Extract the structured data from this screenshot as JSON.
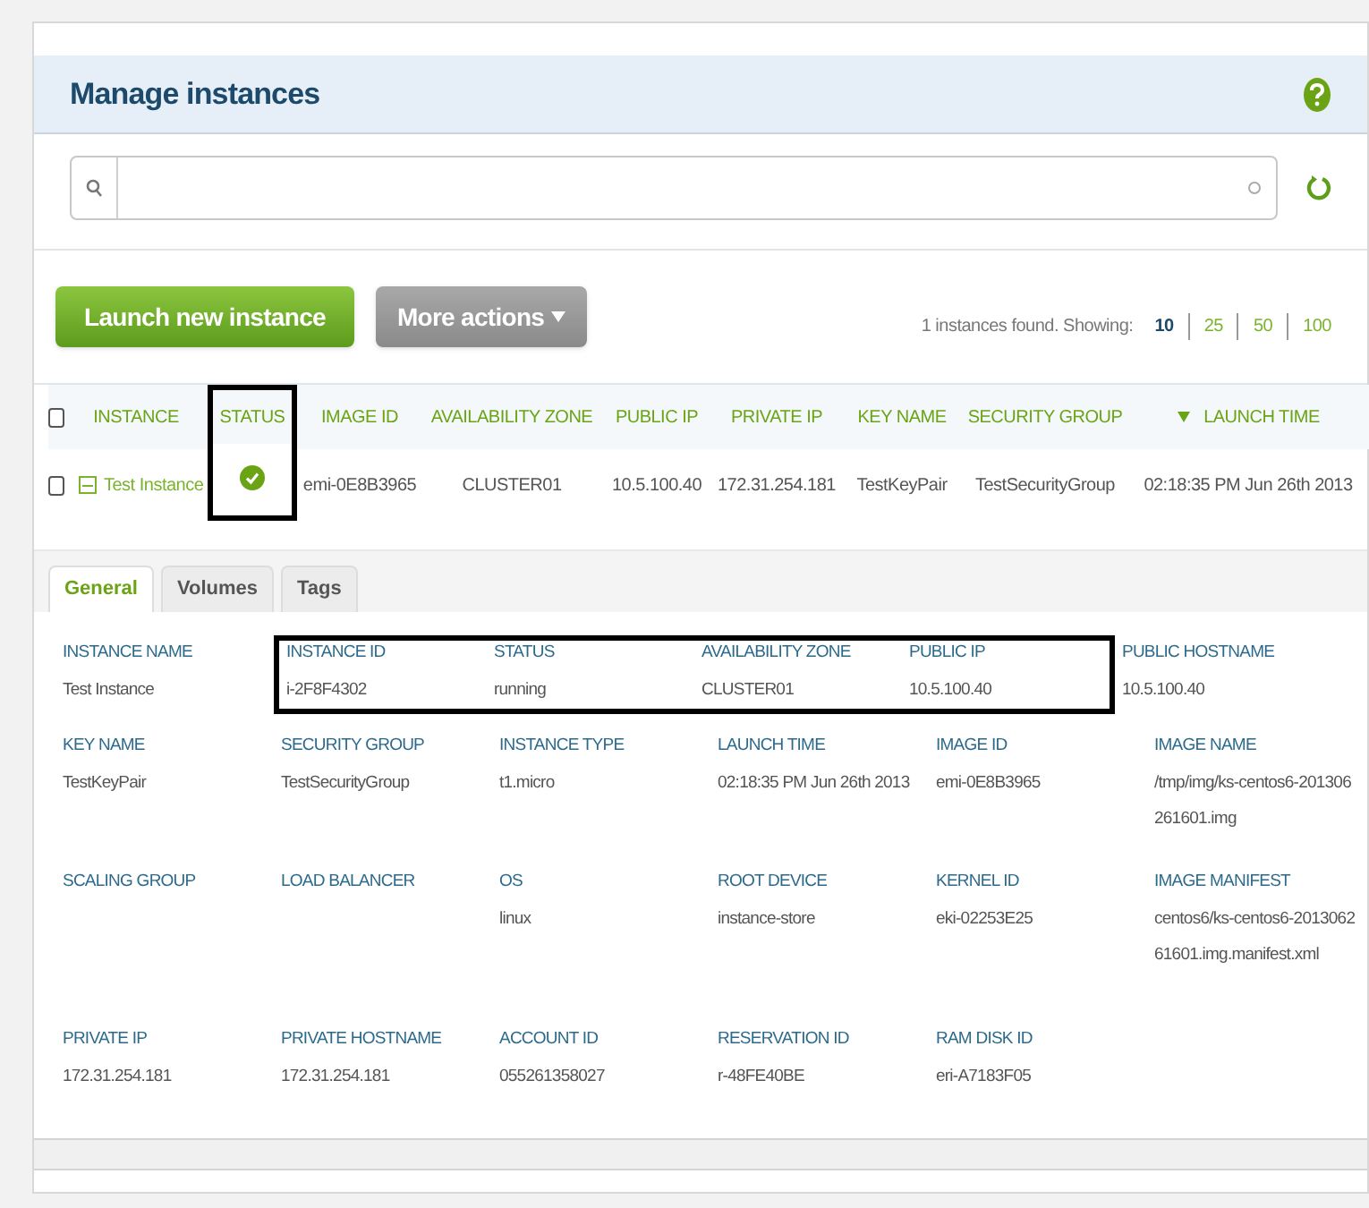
{
  "header": {
    "title": "Manage instances"
  },
  "actions": [
    {
      "kind": "primary",
      "label": "Launch new instance",
      "disabled": false
    },
    {
      "kind": "menu",
      "label": "More actions",
      "disabled": true
    }
  ],
  "summary": "1 instances found. Showing:",
  "page_sizes": [
    {
      "label": "10",
      "selected": true
    },
    {
      "label": "25",
      "selected": false
    },
    {
      "label": "50",
      "selected": false
    },
    {
      "label": "100",
      "selected": false
    }
  ],
  "table": {
    "select_all": {
      "checked": false
    },
    "columns": [
      {
        "label": "INSTANCE",
        "highlighted": false,
        "sorted": false
      },
      {
        "label": "STATUS",
        "highlighted": true,
        "sorted": false
      },
      {
        "label": "IMAGE ID",
        "highlighted": false,
        "sorted": false
      },
      {
        "label": "AVAILABILITY ZONE",
        "highlighted": false,
        "sorted": false
      },
      {
        "label": "PUBLIC IP",
        "highlighted": false,
        "sorted": false
      },
      {
        "label": "PRIVATE IP",
        "highlighted": false,
        "sorted": false
      },
      {
        "label": "KEY NAME",
        "highlighted": false,
        "sorted": false
      },
      {
        "label": "SECURITY GROUP",
        "highlighted": false,
        "sorted": false
      },
      {
        "label": "LAUNCH TIME",
        "highlighted": false,
        "sorted": true
      }
    ],
    "rows": [
      {
        "checked": false,
        "expanded": true,
        "kind": "running",
        "cells": [
          "Test Instance",
          "",
          "emi-0E8B3965",
          "CLUSTER01",
          "10.5.100.40",
          "172.31.254.181",
          "TestKeyPair",
          "TestSecurityGroup",
          "02:18:35 PM Jun 26th 2013"
        ]
      }
    ]
  },
  "detail_tabs": [
    {
      "label": "General",
      "selected": true
    },
    {
      "label": "Volumes",
      "selected": false
    },
    {
      "label": "Tags",
      "selected": false
    }
  ],
  "details": [
    [
      {
        "label": "INSTANCE NAME",
        "value": "Test Instance",
        "highlighted": false
      },
      {
        "label": "INSTANCE ID",
        "value": "i-2F8F4302",
        "highlighted": true
      },
      {
        "label": "STATUS",
        "value": "running",
        "highlighted": true
      },
      {
        "label": "AVAILABILITY ZONE",
        "value": "CLUSTER01",
        "highlighted": true
      },
      {
        "label": "PUBLIC IP",
        "value": "10.5.100.40",
        "highlighted": true
      },
      {
        "label": "PUBLIC HOSTNAME",
        "value": "10.5.100.40",
        "highlighted": false
      }
    ],
    [
      {
        "label": "KEY NAME",
        "value": "TestKeyPair",
        "highlighted": false
      },
      {
        "label": "SECURITY GROUP",
        "value": "TestSecurityGroup",
        "highlighted": false
      },
      {
        "label": "INSTANCE TYPE",
        "value": "t1.micro",
        "highlighted": false
      },
      {
        "label": "LAUNCH TIME",
        "value": "02:18:35 PM Jun 26th 2013",
        "highlighted": false
      },
      {
        "label": "IMAGE ID",
        "value": "emi-0E8B3965",
        "highlighted": false
      },
      {
        "label": "IMAGE NAME",
        "value": "/tmp/img/ks-centos6-201306261601.img",
        "highlighted": false
      }
    ],
    [
      {
        "label": "SCALING GROUP",
        "highlighted": false
      },
      {
        "label": "LOAD BALANCER",
        "highlighted": false
      },
      {
        "label": "OS",
        "value": "linux",
        "highlighted": false
      },
      {
        "label": "ROOT DEVICE",
        "value": "instance-store",
        "highlighted": false
      },
      {
        "label": "KERNEL ID",
        "value": "eki-02253E25",
        "highlighted": false
      },
      {
        "label": "IMAGE MANIFEST",
        "value": "centos6/ks-centos6-201306261601.img.manifest.xml",
        "highlighted": false
      }
    ],
    [
      {
        "label": "PRIVATE IP",
        "value": "172.31.254.181",
        "highlighted": false
      },
      {
        "label": "PRIVATE HOSTNAME",
        "value": "172.31.254.181",
        "highlighted": false
      },
      {
        "label": "ACCOUNT ID",
        "value": "055261358027",
        "highlighted": false
      },
      {
        "label": "RESERVATION ID",
        "value": "r-48FE40BE",
        "highlighted": false
      },
      {
        "label": "RAM DISK ID",
        "value": "eri-A7183F05",
        "highlighted": false
      }
    ]
  ]
}
